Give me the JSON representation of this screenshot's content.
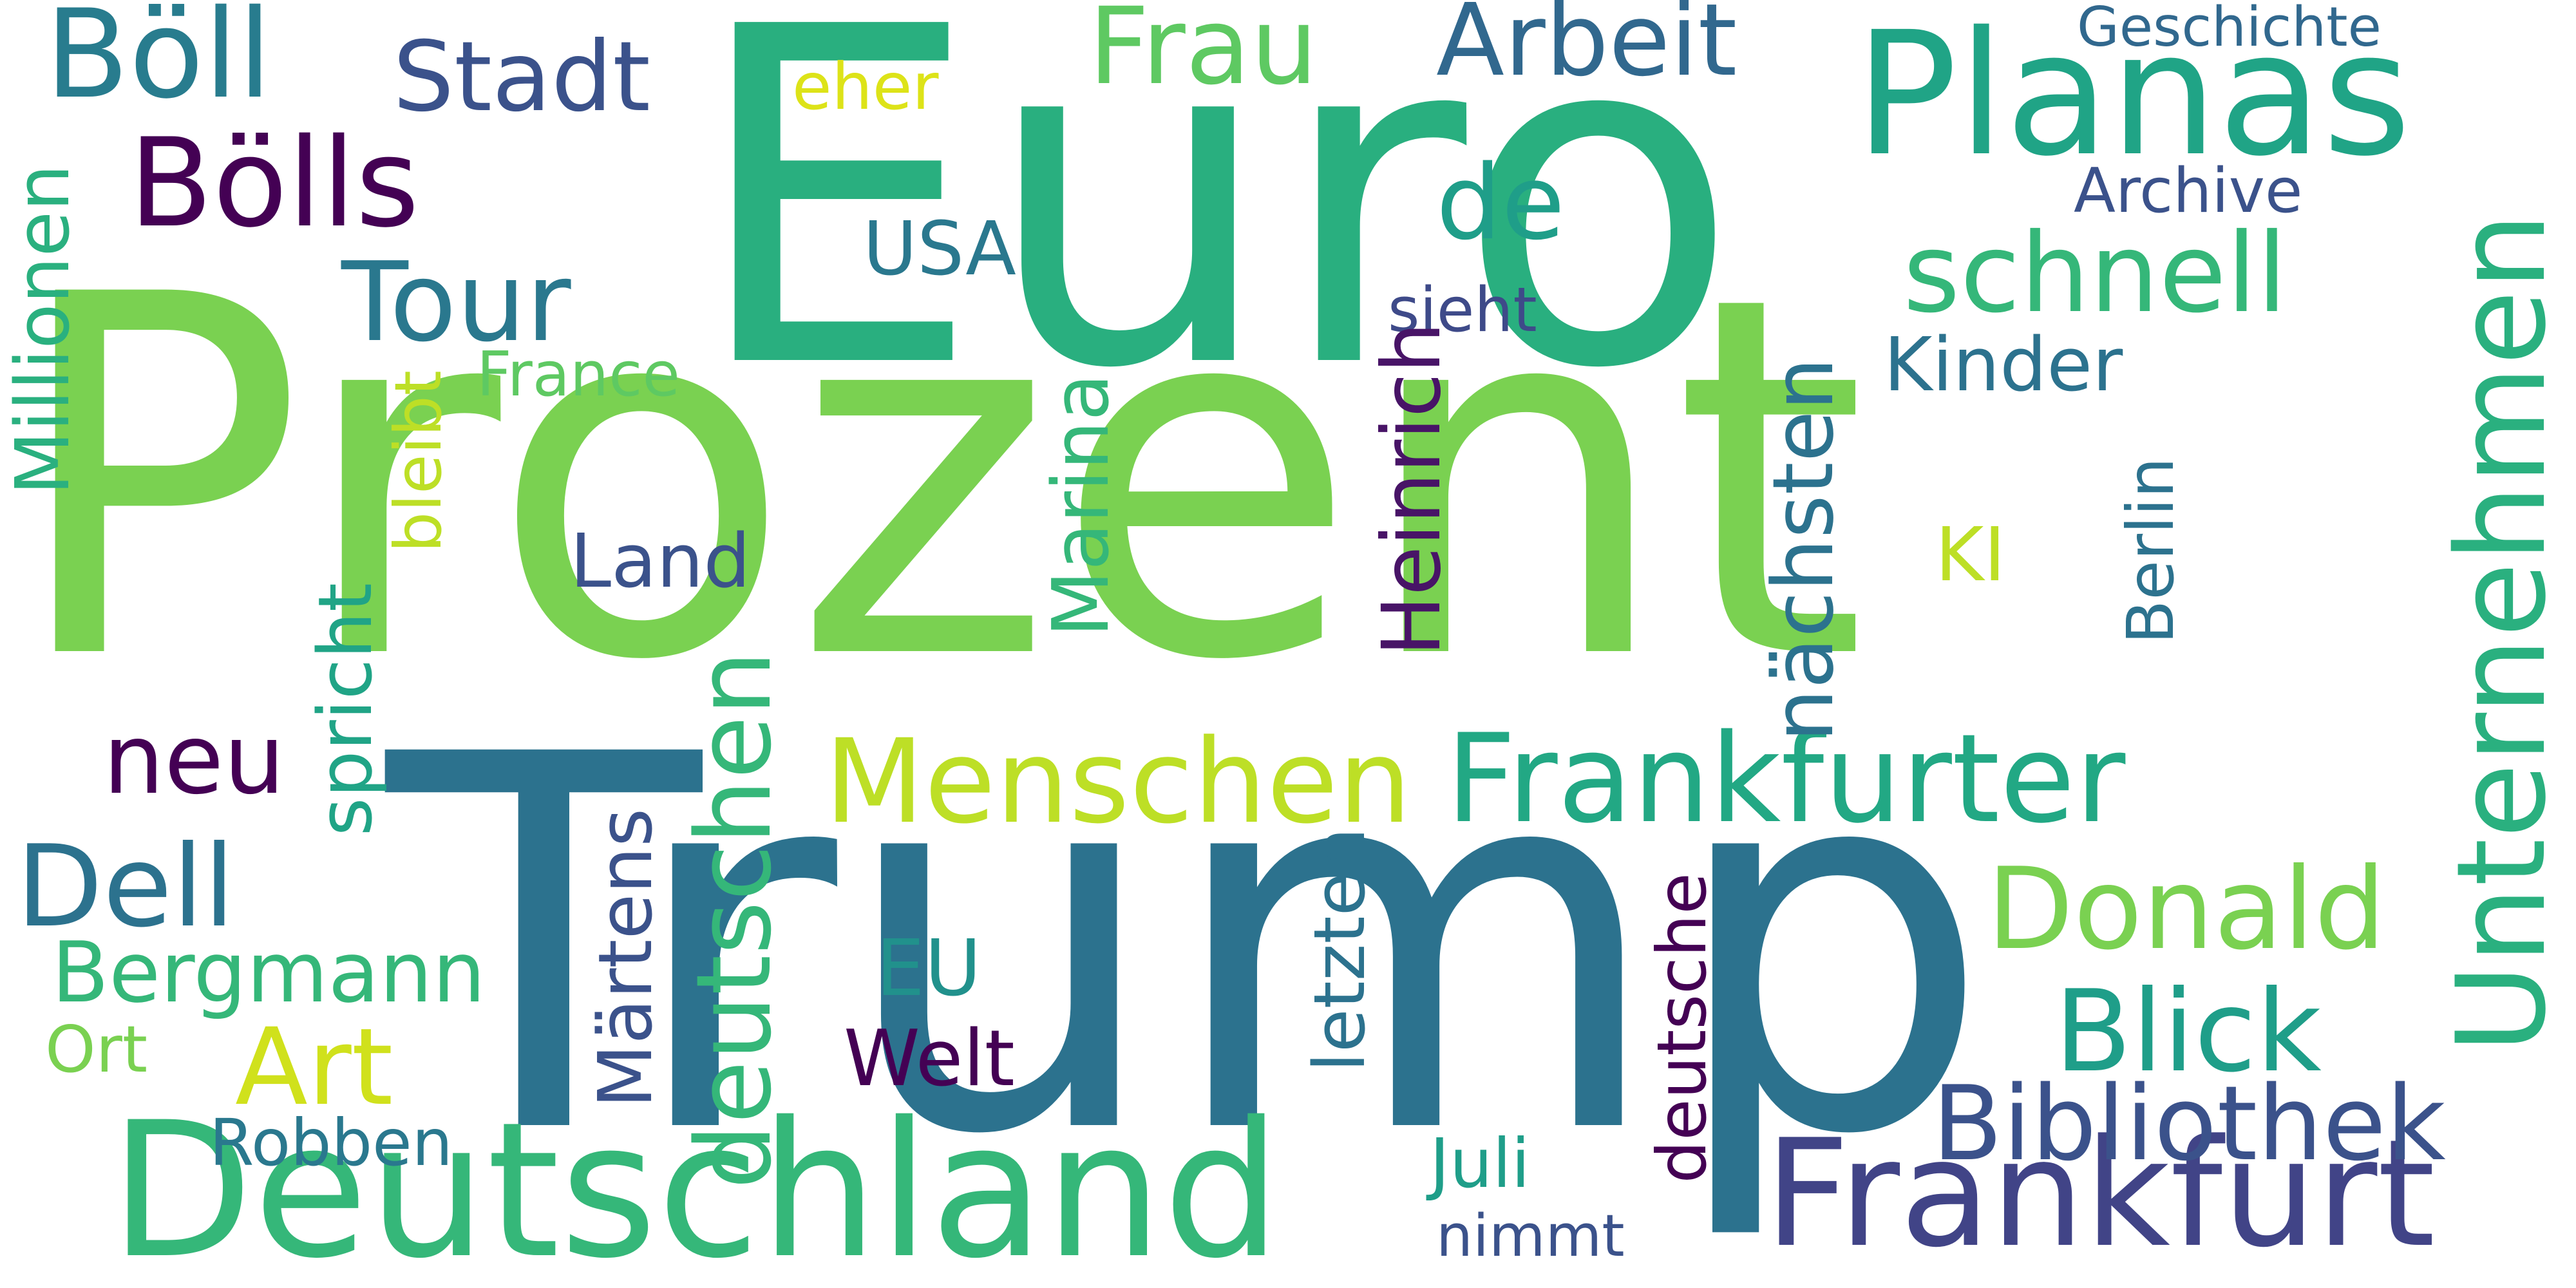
{
  "words": [
    {
      "id": "prozent",
      "text": "Prozent",
      "color": "#7ad151"
    },
    {
      "id": "trump",
      "text": "Trump",
      "color": "#2c728e"
    },
    {
      "id": "euro",
      "text": "Euro",
      "color": "#29af7f"
    },
    {
      "id": "deutschland",
      "text": "Deutschland",
      "color": "#35b779"
    },
    {
      "id": "planas",
      "text": "Planas",
      "color": "#20a486"
    },
    {
      "id": "frankfurt",
      "text": "Frankfurt",
      "color": "#414487"
    },
    {
      "id": "frankfurter",
      "text": "Frankfurter",
      "color": "#22a884"
    },
    {
      "id": "unternehmen",
      "text": "Unternehmen",
      "color": "#2ab07f"
    },
    {
      "id": "menschen",
      "text": "Menschen",
      "color": "#bddf26"
    },
    {
      "id": "boells",
      "text": "Bölls",
      "color": "#440154"
    },
    {
      "id": "boell",
      "text": "Böll",
      "color": "#287c8e"
    },
    {
      "id": "bibliothek",
      "text": "Bibliothek",
      "color": "#3b528b"
    },
    {
      "id": "blick",
      "text": "Blick",
      "color": "#1f9e89"
    },
    {
      "id": "donald",
      "text": "Donald",
      "color": "#7ad151"
    },
    {
      "id": "dell",
      "text": "Dell",
      "color": "#2c728e"
    },
    {
      "id": "deutschen",
      "text": "deutschen",
      "color": "#35b779"
    },
    {
      "id": "schnell",
      "text": "schnell",
      "color": "#35b779"
    },
    {
      "id": "tour",
      "text": "Tour",
      "color": "#2a788e"
    },
    {
      "id": "stadt",
      "text": "Stadt",
      "color": "#3b528b"
    },
    {
      "id": "frau",
      "text": "Frau",
      "color": "#5ec962"
    },
    {
      "id": "arbeit",
      "text": "Arbeit",
      "color": "#31688e"
    },
    {
      "id": "de",
      "text": "de",
      "color": "#1f9e89"
    },
    {
      "id": "heinrich",
      "text": "Heinrich",
      "color": "#481467"
    },
    {
      "id": "naechsten",
      "text": "nächsten",
      "color": "#2c728e"
    },
    {
      "id": "marina",
      "text": "Marina",
      "color": "#35b779"
    },
    {
      "id": "millionen",
      "text": "Millionen",
      "color": "#2ab07f"
    },
    {
      "id": "maertens",
      "text": "Märtens",
      "color": "#3b528b"
    },
    {
      "id": "deutsche",
      "text": "deutsche",
      "color": "#440154"
    },
    {
      "id": "letzten",
      "text": "letzten",
      "color": "#2c728e"
    },
    {
      "id": "spricht",
      "text": "spricht",
      "color": "#20a486"
    },
    {
      "id": "bleibt",
      "text": "bleibt",
      "color": "#bddf26"
    },
    {
      "id": "berlin",
      "text": "Berlin",
      "color": "#2c728e"
    },
    {
      "id": "bergmann",
      "text": "Bergmann",
      "color": "#35b779"
    },
    {
      "id": "art",
      "text": "Art",
      "color": "#d0e11c"
    },
    {
      "id": "neu",
      "text": "neu",
      "color": "#440154"
    },
    {
      "id": "kinder",
      "text": "Kinder",
      "color": "#2c728e"
    },
    {
      "id": "land",
      "text": "Land",
      "color": "#3b528b"
    },
    {
      "id": "usa",
      "text": "USA",
      "color": "#2a788e"
    },
    {
      "id": "eu",
      "text": "EU",
      "color": "#21918c"
    },
    {
      "id": "welt",
      "text": "Welt",
      "color": "#440154"
    },
    {
      "id": "robben",
      "text": "Robben",
      "color": "#2a788e"
    },
    {
      "id": "ort",
      "text": "Ort",
      "color": "#7ad151"
    },
    {
      "id": "juli",
      "text": "Juli",
      "color": "#1f9e89"
    },
    {
      "id": "nimmt",
      "text": "nimmt",
      "color": "#3b528b"
    },
    {
      "id": "ki",
      "text": "KI",
      "color": "#bddf26"
    },
    {
      "id": "france",
      "text": "France",
      "color": "#5ec962"
    },
    {
      "id": "sieht",
      "text": "sieht",
      "color": "#3e4a89"
    },
    {
      "id": "archive",
      "text": "Archive",
      "color": "#3b528b"
    },
    {
      "id": "geschichte",
      "text": "Geschichte",
      "color": "#31688e"
    },
    {
      "id": "eher",
      "text": "eher",
      "color": "#dde318"
    }
  ]
}
